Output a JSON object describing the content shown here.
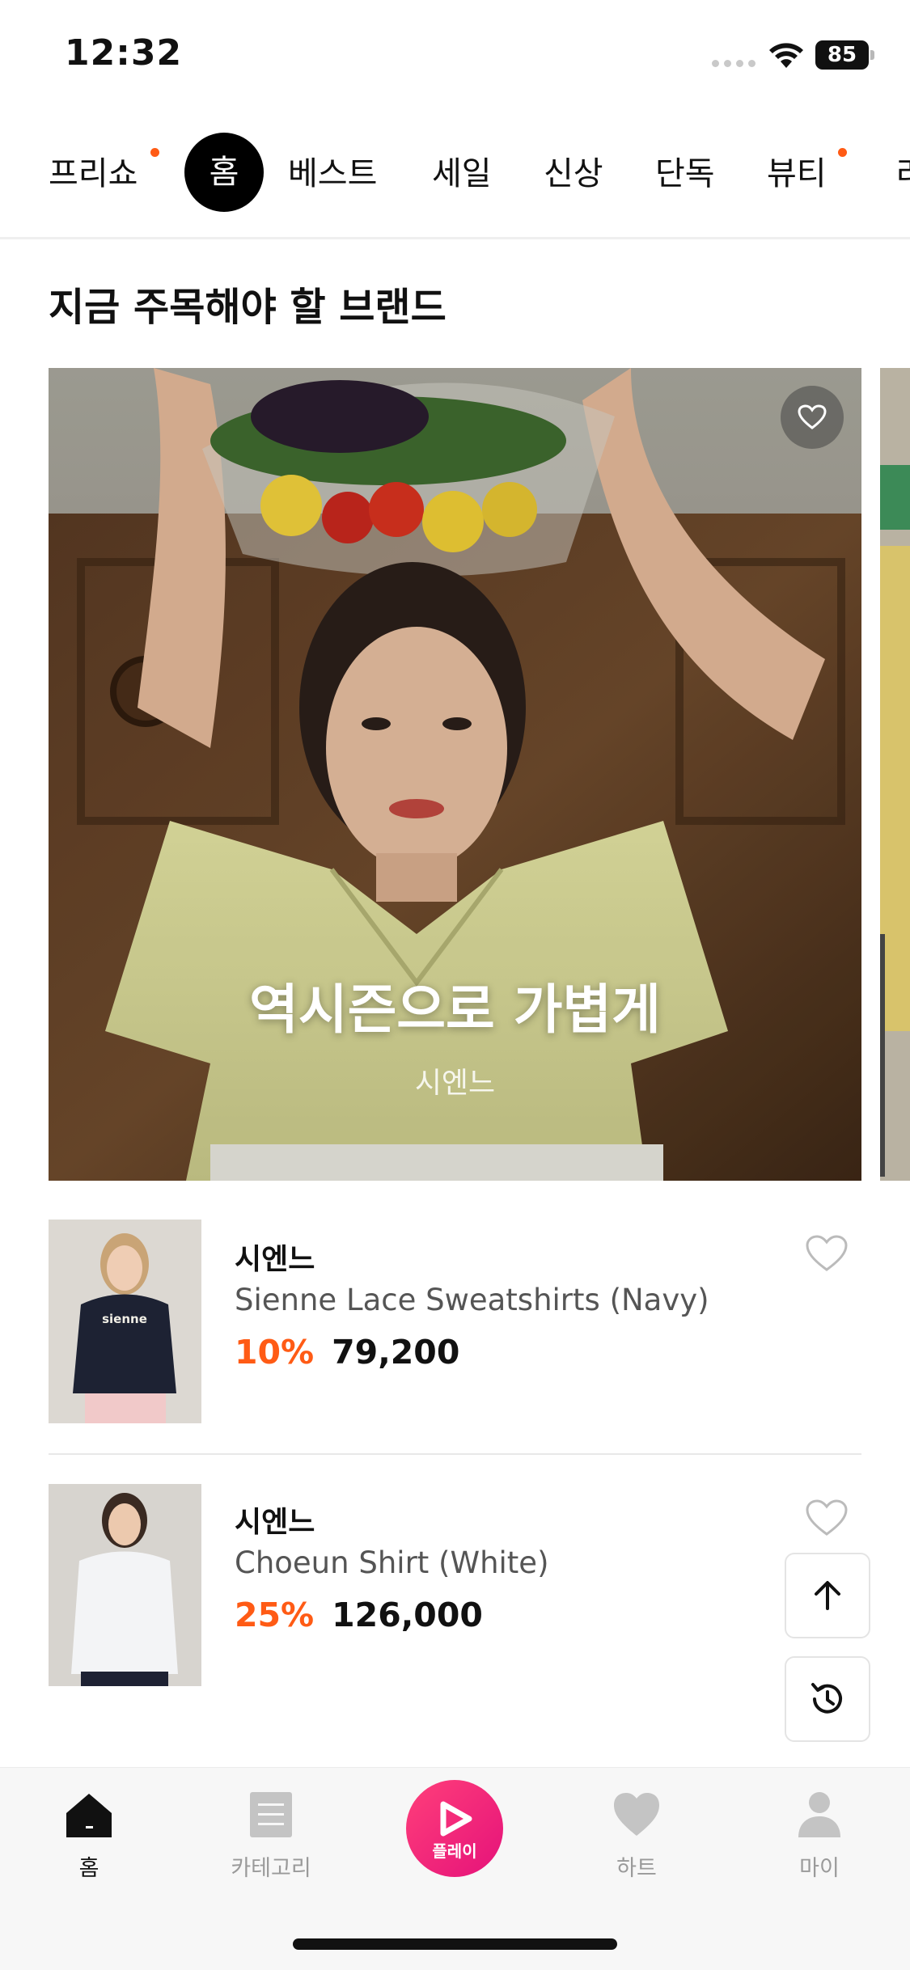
{
  "status_bar": {
    "time": "12:32",
    "battery": "85"
  },
  "category_tabs": [
    {
      "label": "프리쇼",
      "dot": true
    },
    {
      "label": "홈",
      "active": true
    },
    {
      "label": "베스트"
    },
    {
      "label": "세일"
    },
    {
      "label": "신상"
    },
    {
      "label": "단독"
    },
    {
      "label": "뷰티",
      "dot": true
    },
    {
      "label": "라"
    }
  ],
  "section": {
    "title": "지금 주목해야 할 브랜드"
  },
  "hero": {
    "title": "역시즌으로 가볍게",
    "brand": "시엔느"
  },
  "products": [
    {
      "brand": "시엔느",
      "name": "Sienne Lace Sweatshirts (Navy)",
      "discount": "10%",
      "price": "79,200",
      "thumb_text": "sienne"
    },
    {
      "brand": "시엔느",
      "name": "Choeun Shirt (White)",
      "discount": "25%",
      "price": "126,000"
    }
  ],
  "bottom_nav": [
    {
      "label": "홈",
      "icon": "home-icon",
      "active": true
    },
    {
      "label": "카테고리",
      "icon": "category-icon"
    },
    {
      "label": "플레이",
      "icon": "play-icon"
    },
    {
      "label": "하트",
      "icon": "heart-icon"
    },
    {
      "label": "마이",
      "icon": "profile-icon"
    }
  ],
  "colors": {
    "accent": "#ff5b15",
    "play": "#e8157c",
    "text": "#111111"
  }
}
